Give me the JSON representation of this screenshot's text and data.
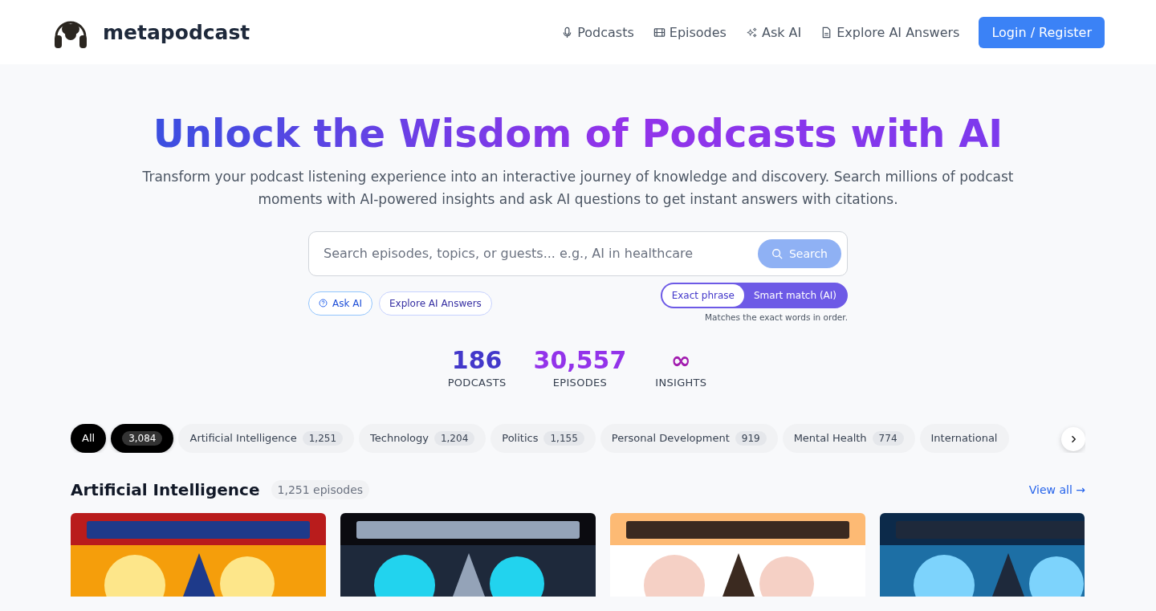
{
  "header": {
    "brand": "metapodcast",
    "nav": [
      {
        "label": "Podcasts",
        "kind": "mic"
      },
      {
        "label": "Episodes",
        "kind": "film"
      },
      {
        "label": "Ask AI",
        "kind": "sparkle"
      },
      {
        "label": "Explore AI Answers",
        "kind": "doc"
      }
    ],
    "login": "Login / Register"
  },
  "hero": {
    "title": "Unlock the Wisdom of Podcasts with AI",
    "subtitle": "Transform your podcast listening experience into an interactive journey of knowledge and discovery. Search millions of podcast moments with AI-powered insights and ask AI questions to get instant answers with citations."
  },
  "search": {
    "placeholder": "Search episodes, topics, or guests... e.g., AI in healthcare",
    "button": "Search",
    "links": [
      {
        "label": "Ask AI",
        "kind": "help"
      },
      {
        "label": "Explore AI Answers",
        "kind": "plain"
      }
    ],
    "modes": [
      {
        "label": "Exact phrase",
        "selected": true
      },
      {
        "label": "Smart match (AI)",
        "selected": false
      }
    ],
    "hint": "Matches the exact words in order."
  },
  "stats": [
    {
      "value": "186",
      "label": "PODCASTS",
      "color": "#4338ca"
    },
    {
      "value": "30,557",
      "label": "EPISODES",
      "color": "#9333ea"
    },
    {
      "value": "∞",
      "label": "INSIGHTS",
      "color": "#a21caf"
    }
  ],
  "categories": [
    {
      "label": "All",
      "selected": true
    },
    {
      "count": "3,084",
      "selected": true
    },
    {
      "label": "Artificial Intelligence",
      "count": "1,251",
      "selected": false
    },
    {
      "label": "Technology",
      "count": "1,204",
      "selected": false
    },
    {
      "label": "Politics",
      "count": "1,155",
      "selected": false
    },
    {
      "label": "Personal Development",
      "count": "919",
      "selected": false
    },
    {
      "label": "Mental Health",
      "count": "774",
      "selected": false
    },
    {
      "label": "International",
      "selected": false
    }
  ],
  "section": {
    "title": "Artificial Intelligence",
    "count": "1,251 episodes",
    "view_all": "View all →"
  }
}
